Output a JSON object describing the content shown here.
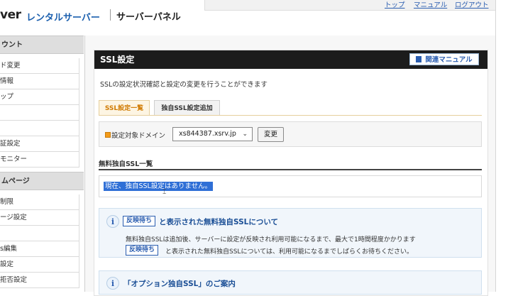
{
  "header": {
    "logo_fragment": "ver",
    "logo_subtitle": "レンタルサーバー",
    "panel_name": "サーバーパネル",
    "links": [
      "トップ",
      "マニュアル",
      "ログアウト"
    ]
  },
  "sidebar": {
    "section1_title": "ウント",
    "section1_items": [
      "ド変更",
      "情報",
      "ップ",
      "",
      "",
      "証設定",
      "モニター"
    ],
    "section2_title": "ムページ",
    "section2_items": [
      "制限",
      "ージ設定",
      "",
      "s編集",
      "設定",
      "拒否設定"
    ]
  },
  "panel": {
    "title": "SSL設定",
    "manual_button": "関連マニュアル",
    "description": "SSLの設定状況確認と設定の変更を行うことができます",
    "tabs": [
      "SSL設定一覧",
      "独自SSL設定追加"
    ],
    "domain_label": "設定対象ドメイン",
    "domain_value": "xs844387.xsrv.jp",
    "change_button": "変更",
    "list_title": "無料独自SSL一覧",
    "empty_message": "現在、独自SSL設定はありません。",
    "info1": {
      "badge": "反映待ち",
      "title_suffix": "と表示された無料独自SSLについて",
      "line1": "無料独自SSLは追加後、サーバーに設定が反映され利用可能になるまで、最大で1時間程度かかります",
      "badge2": "反映待ち",
      "line2": "と表示された無料独自SSLについては、利用可能になるまでしばらくお待ちください。"
    },
    "info2": {
      "title": "「オプション独自SSL」のご案内"
    }
  },
  "colors": {
    "accent_blue": "#2a5db0",
    "tab_orange": "#d07a00",
    "title_bar": "#1c1c1c",
    "selection": "#2f6fd6"
  }
}
